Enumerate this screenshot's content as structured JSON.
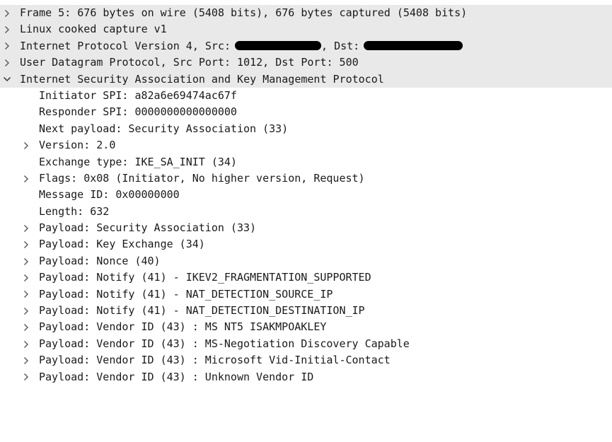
{
  "packet_tree": {
    "frame": {
      "label": "Frame 5: 676 bytes on wire (5408 bits), 676 bytes captured (5408 bits)",
      "expanded": false
    },
    "linux_cooked": {
      "label": "Linux cooked capture v1",
      "expanded": false
    },
    "ipv4": {
      "label_prefix": "Internet Protocol Version 4, Src:",
      "dst_label": ", Dst:",
      "expanded": false
    },
    "udp": {
      "label": "User Datagram Protocol, Src Port: 1012, Dst Port: 500",
      "expanded": false
    },
    "isakmp": {
      "label": "Internet Security Association and Key Management Protocol",
      "expanded": true,
      "fields": [
        {
          "label": "Initiator SPI: a82a6e69474ac67f",
          "expandable": false
        },
        {
          "label": "Responder SPI: 0000000000000000",
          "expandable": false
        },
        {
          "label": "Next payload: Security Association (33)",
          "expandable": false
        },
        {
          "label": "Version: 2.0",
          "expandable": true
        },
        {
          "label": "Exchange type: IKE_SA_INIT (34)",
          "expandable": false
        },
        {
          "label": "Flags: 0x08 (Initiator, No higher version, Request)",
          "expandable": true
        },
        {
          "label": "Message ID: 0x00000000",
          "expandable": false
        },
        {
          "label": "Length: 632",
          "expandable": false
        },
        {
          "label": "Payload: Security Association (33)",
          "expandable": true
        },
        {
          "label": "Payload: Key Exchange (34)",
          "expandable": true
        },
        {
          "label": "Payload: Nonce (40)",
          "expandable": true
        },
        {
          "label": "Payload: Notify (41) - IKEV2_FRAGMENTATION_SUPPORTED",
          "expandable": true
        },
        {
          "label": "Payload: Notify (41) - NAT_DETECTION_SOURCE_IP",
          "expandable": true
        },
        {
          "label": "Payload: Notify (41) - NAT_DETECTION_DESTINATION_IP",
          "expandable": true
        },
        {
          "label": "Payload: Vendor ID (43) : MS NT5 ISAKMPOAKLEY",
          "expandable": true
        },
        {
          "label": "Payload: Vendor ID (43) : MS-Negotiation Discovery Capable",
          "expandable": true
        },
        {
          "label": "Payload: Vendor ID (43) : Microsoft Vid-Initial-Contact",
          "expandable": true
        },
        {
          "label": "Payload: Vendor ID (43) : Unknown Vendor ID",
          "expandable": true
        }
      ]
    }
  },
  "icons": {
    "collapsed": "chevron-right-icon",
    "expanded": "chevron-down-icon"
  },
  "colors": {
    "top_row_background": "#e9e9e9",
    "text": "#1a1a1a",
    "arrow": "#555555",
    "redaction": "#000000"
  }
}
